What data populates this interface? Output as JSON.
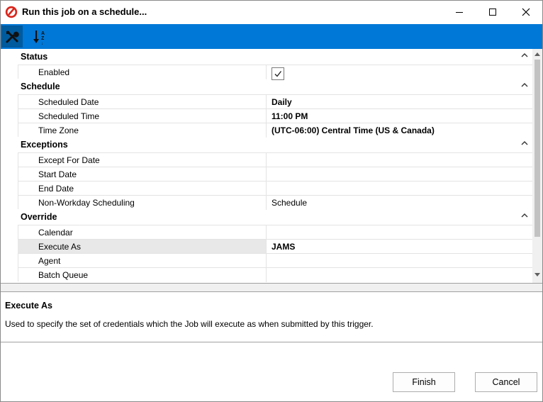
{
  "window": {
    "title": "Run this job on a schedule...",
    "controls": [
      "minimize",
      "maximize",
      "close"
    ]
  },
  "toolbar": {
    "tools": [
      {
        "icon": "wrench-tools-icon",
        "active": true
      },
      {
        "icon": "sort-az-icon",
        "active": false
      }
    ],
    "accent": "#0078d7"
  },
  "grid": {
    "categories": [
      {
        "label": "Status",
        "rows": [
          {
            "name": "Enabled",
            "value": "",
            "checked": true
          }
        ]
      },
      {
        "label": "Schedule",
        "rows": [
          {
            "name": "Scheduled Date",
            "value": "Daily",
            "bold": true
          },
          {
            "name": "Scheduled Time",
            "value": "11:00 PM",
            "bold": true
          },
          {
            "name": "Time Zone",
            "value": "(UTC-06:00) Central Time (US & Canada)",
            "bold": true
          }
        ]
      },
      {
        "label": "Exceptions",
        "rows": [
          {
            "name": "Except For Date",
            "value": ""
          },
          {
            "name": "Start Date",
            "value": ""
          },
          {
            "name": "End Date",
            "value": ""
          },
          {
            "name": "Non-Workday Scheduling",
            "value": "Schedule"
          }
        ]
      },
      {
        "label": "Override",
        "rows": [
          {
            "name": "Calendar",
            "value": ""
          },
          {
            "name": "Execute As",
            "value": "JAMS",
            "bold": true,
            "selected": true
          },
          {
            "name": "Agent",
            "value": ""
          },
          {
            "name": "Batch Queue",
            "value": ""
          }
        ]
      }
    ]
  },
  "help": {
    "title": "Execute As",
    "text": "Used to specify the set of credentials which the Job will execute as when submitted by this trigger."
  },
  "buttons": {
    "finish": "Finish",
    "cancel": "Cancel"
  }
}
